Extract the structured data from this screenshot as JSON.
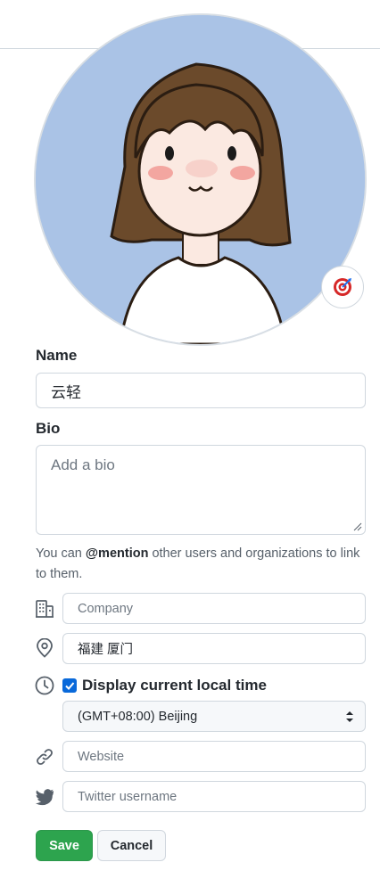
{
  "profile": {
    "name_label": "Name",
    "name_value": "云轻",
    "bio_label": "Bio",
    "bio_placeholder": "Add a bio",
    "bio_value": "",
    "hint_prefix": "You can ",
    "hint_mention": "@mention",
    "hint_suffix": " other users and organizations to link to them.",
    "company_placeholder": "Company",
    "company_value": "",
    "location_value": "福建 厦门",
    "local_time_label": "Display current local time",
    "local_time_checked": true,
    "timezone_selected": "(GMT+08:00) Beijing",
    "website_placeholder": "Website",
    "website_value": "",
    "twitter_placeholder": "Twitter username",
    "twitter_value": ""
  },
  "buttons": {
    "save_label": "Save",
    "cancel_label": "Cancel"
  },
  "icons": {
    "status": "dart-target-emoji",
    "company": "organization-icon",
    "location": "location-pin-icon",
    "time": "clock-icon",
    "website": "link-icon",
    "twitter": "twitter-bird-icon"
  },
  "colors": {
    "primary_green": "#2da44e",
    "checkbox_blue": "#0969da",
    "border": "#d0d7de",
    "muted_text": "#57606a",
    "avatar_bg": "#aac3e6"
  }
}
